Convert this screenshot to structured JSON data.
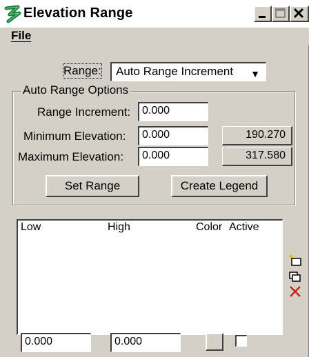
{
  "window": {
    "title": "Elevation Range",
    "controls": {
      "minimize": "_",
      "maximize": "□",
      "close": "×"
    }
  },
  "menu": {
    "file": "File"
  },
  "range": {
    "label": "Range:",
    "selected": "Auto Range Increment"
  },
  "auto_options": {
    "title": "Auto Range Options",
    "range_increment_label": "Range Increment:",
    "range_increment_value": "0.000",
    "min_label": "Minimum Elevation:",
    "min_value": "0.000",
    "min_readout": "190.270",
    "max_label": "Maximum Elevation:",
    "max_value": "0.000",
    "max_readout": "317.580",
    "set_range": "Set Range",
    "create_legend": "Create Legend"
  },
  "list": {
    "columns": [
      "Low",
      "High",
      "Color",
      "Active"
    ],
    "rows": []
  },
  "bottom": {
    "low_value": "0.000",
    "high_value": "0.000",
    "active_checked": false
  },
  "icons": [
    "new-entry-icon",
    "duplicate-entry-icon",
    "delete-entry-icon"
  ],
  "colors": {
    "delete": "#c0281c",
    "title_icon": "#1a7a3a"
  }
}
